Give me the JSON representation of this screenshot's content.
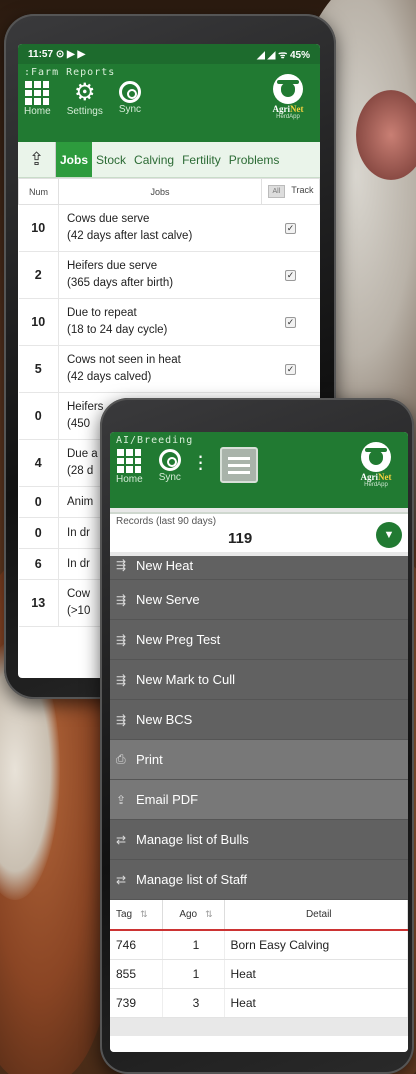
{
  "phone1": {
    "status_time": "11:57",
    "status_icons_left": "⊙ ▶ ▶",
    "status_icons_right": "◢ ◢ ᯤ 45%",
    "app_title": ":Farm Reports",
    "toolbar": [
      {
        "label": "Home",
        "icon": "grid-icon"
      },
      {
        "label": "Settings",
        "icon": "gear-icon"
      },
      {
        "label": "Sync",
        "icon": "sync-icon"
      }
    ],
    "logo": {
      "name_a": "Agri",
      "name_b": "Net",
      "sub": "HerdApp"
    },
    "tabs": [
      "Jobs",
      "Stock",
      "Calving",
      "Fertility",
      "Problems"
    ],
    "table_headers": {
      "num": "Num",
      "jobs": "Jobs",
      "all": "All",
      "track": "Track"
    },
    "rows": [
      {
        "num": "10",
        "line1": "Cows due serve",
        "line2": "(42 days after last calve)",
        "checked": "✓"
      },
      {
        "num": "2",
        "line1": "Heifers due serve",
        "line2": "(365 days after birth)",
        "checked": "✓"
      },
      {
        "num": "10",
        "line1": "Due to repeat",
        "line2": "(18 to 24 day cycle)",
        "checked": "✓"
      },
      {
        "num": "5",
        "line1": "Cows not seen in heat",
        "line2": "(42 days calved)",
        "checked": "✓"
      },
      {
        "num": "0",
        "line1": "Heifers",
        "line2": "(450",
        "checked": ""
      },
      {
        "num": "4",
        "line1": "Due a",
        "line2": "(28 d",
        "checked": ""
      },
      {
        "num": "0",
        "line1": "Anim",
        "line2": "",
        "checked": ""
      },
      {
        "num": "0",
        "line1": "In dr",
        "line2": "",
        "checked": ""
      },
      {
        "num": "6",
        "line1": "In dr",
        "line2": "",
        "checked": ""
      },
      {
        "num": "13",
        "line1": "Cow",
        "line2": "(>10",
        "checked": ""
      }
    ]
  },
  "phone2": {
    "app_title": "AI/Breeding",
    "toolbar": [
      {
        "label": "Home",
        "icon": "grid-icon"
      },
      {
        "label": "Sync",
        "icon": "sync-icon"
      }
    ],
    "logo": {
      "name_a": "Agri",
      "name_b": "Net",
      "sub": "HerdApp"
    },
    "records_label": "Records (last 90 days)",
    "records_value": "119",
    "menu": [
      {
        "label": "New Heat",
        "icon": "add-icon"
      },
      {
        "label": "New Serve",
        "icon": "add-icon"
      },
      {
        "label": "New Preg Test",
        "icon": "add-icon"
      },
      {
        "label": "New Mark to Cull",
        "icon": "add-icon"
      },
      {
        "label": "New BCS",
        "icon": "add-icon"
      },
      {
        "label": "Print",
        "icon": "print-icon"
      },
      {
        "label": "Email PDF",
        "icon": "email-icon"
      },
      {
        "label": "Manage list of Bulls",
        "icon": "list-icon"
      },
      {
        "label": "Manage list of Staff",
        "icon": "list-icon"
      }
    ],
    "table_headers": {
      "tag": "Tag",
      "ago": "Ago",
      "detail": "Detail"
    },
    "rows": [
      {
        "tag": "746",
        "ago": "1",
        "detail": "Born Easy Calving"
      },
      {
        "tag": "855",
        "ago": "1",
        "detail": "Heat"
      },
      {
        "tag": "739",
        "ago": "3",
        "detail": "Heat"
      }
    ]
  },
  "colors": {
    "brand_green": "#217a32",
    "tab_active": "#2d9b3d",
    "menu_bg": "#616161"
  }
}
